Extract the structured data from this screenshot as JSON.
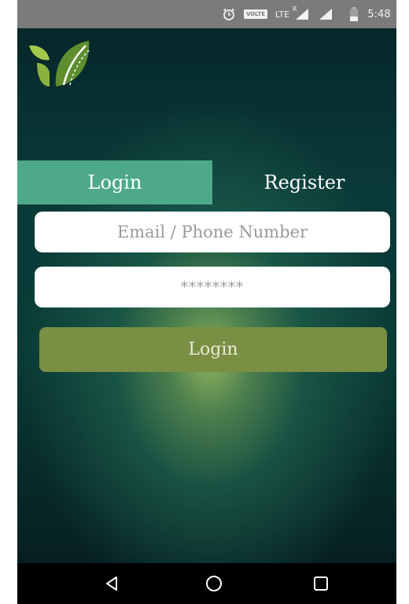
{
  "status_bar": {
    "time": "5:48",
    "network_label": "LTE",
    "volte_badge": "VOLTE",
    "roaming_mark": "R",
    "icons": [
      "alarm-icon",
      "volte-icon",
      "lte-signal-icon",
      "signal-icon",
      "battery-icon"
    ]
  },
  "logo": {
    "name": "leaf-road-logo",
    "colors": {
      "leaf_light": "#a4c84a",
      "leaf_dark": "#5e8e2e",
      "road": "#ffffff"
    }
  },
  "tabs": [
    {
      "label": "Login",
      "active": true
    },
    {
      "label": "Register",
      "active": false
    }
  ],
  "form": {
    "email_placeholder": "Email / Phone Number",
    "email_value": "",
    "password_placeholder": "********",
    "password_value": ""
  },
  "login_button": {
    "label": "Login"
  },
  "nav_bar": {
    "icons": [
      "back-icon",
      "home-icon",
      "recents-icon"
    ]
  },
  "colors": {
    "active_tab": "#4ea98a",
    "login_button": "#7a8f44",
    "background_dark": "#0a3b36",
    "background_glow": "#96b95f",
    "status_bar": "#7b7b7b",
    "nav_bar": "#000000"
  }
}
